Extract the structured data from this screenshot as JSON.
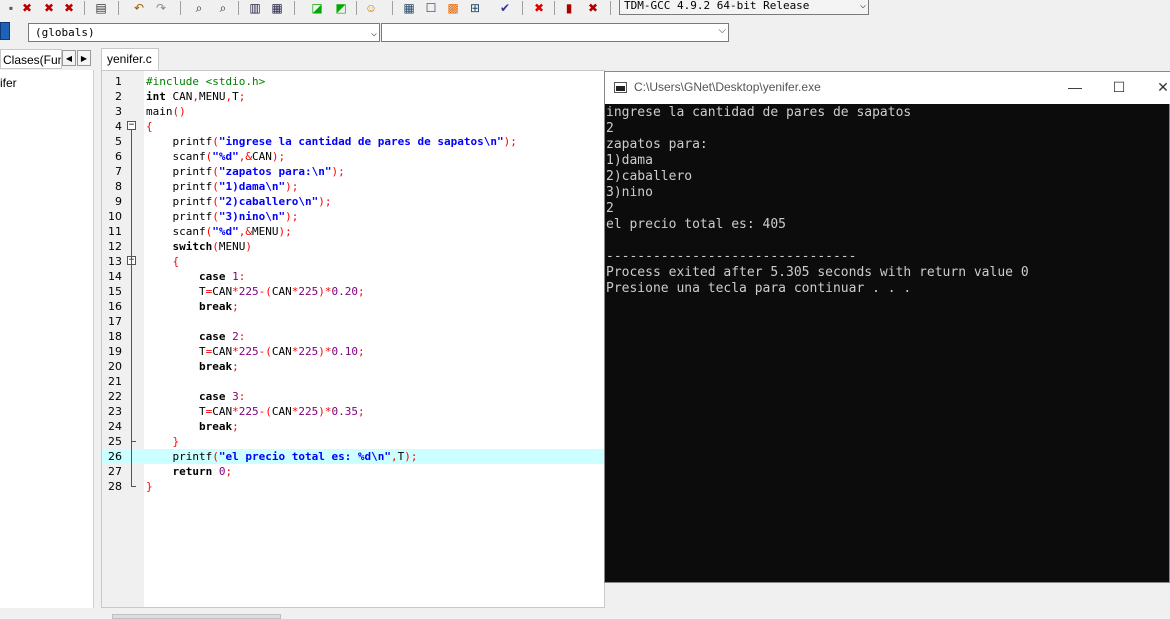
{
  "toolbar": {
    "icons": [
      "print-icon",
      "undo-icon",
      "redo-icon",
      "find-icon",
      "replace-icon",
      "indent-icon",
      "unindent-icon",
      "goto-icon",
      "bookmark-icon",
      "smiley-icon",
      "grid-icon",
      "new-class-icon",
      "colors-icon",
      "tiles-icon",
      "check-icon",
      "stop-icon",
      "chart-icon",
      "delete-icon"
    ],
    "compiler": "TDM-GCC 4.9.2 64-bit Release"
  },
  "scope": {
    "globals": "(globals)",
    "function": ""
  },
  "left_panel": {
    "tab_label": "Clases(Fun",
    "item": "ifer"
  },
  "editor": {
    "file_tab": "yenifer.c",
    "highlight_line": 26,
    "lines": [
      {
        "n": "1",
        "text": "#include <stdio.h>"
      },
      {
        "n": "2",
        "text": "int CAN,MENU,T;"
      },
      {
        "n": "3",
        "text": "main()"
      },
      {
        "n": "4",
        "text": "{"
      },
      {
        "n": "5",
        "text": "    printf(\"ingrese la cantidad de pares de sapatos\\n\");"
      },
      {
        "n": "6",
        "text": "    scanf(\"%d\",&CAN);"
      },
      {
        "n": "7",
        "text": "    printf(\"zapatos para:\\n\");"
      },
      {
        "n": "8",
        "text": "    printf(\"1)dama\\n\");"
      },
      {
        "n": "9",
        "text": "    printf(\"2)caballero\\n\");"
      },
      {
        "n": "10",
        "text": "    printf(\"3)nino\\n\");"
      },
      {
        "n": "11",
        "text": "    scanf(\"%d\",&MENU);"
      },
      {
        "n": "12",
        "text": "    switch(MENU)"
      },
      {
        "n": "13",
        "text": "    {"
      },
      {
        "n": "14",
        "text": "        case 1:"
      },
      {
        "n": "15",
        "text": "        T=CAN*225-(CAN*225)*0.20;"
      },
      {
        "n": "16",
        "text": "        break;"
      },
      {
        "n": "17",
        "text": ""
      },
      {
        "n": "18",
        "text": "        case 2:"
      },
      {
        "n": "19",
        "text": "        T=CAN*225-(CAN*225)*0.10;"
      },
      {
        "n": "20",
        "text": "        break;"
      },
      {
        "n": "21",
        "text": ""
      },
      {
        "n": "22",
        "text": "        case 3:"
      },
      {
        "n": "23",
        "text": "        T=CAN*225-(CAN*225)*0.35;"
      },
      {
        "n": "24",
        "text": "        break;"
      },
      {
        "n": "25",
        "text": "    }"
      },
      {
        "n": "26",
        "text": "    printf(\"el precio total es: %d\\n\",T);"
      },
      {
        "n": "27",
        "text": "    return 0;"
      },
      {
        "n": "28",
        "text": "}"
      }
    ]
  },
  "console": {
    "title": "C:\\Users\\GNet\\Desktop\\yenifer.exe",
    "minimize": "—",
    "maximize": "☐",
    "close": "✕",
    "lines": [
      "ingrese la cantidad de pares de sapatos",
      "2",
      "zapatos para:",
      "1)dama",
      "2)caballero",
      "3)nino",
      "2",
      "el precio total es: 405",
      "",
      "--------------------------------",
      "Process exited after 5.305 seconds with return value 0",
      "Presione una tecla para continuar . . ."
    ]
  }
}
